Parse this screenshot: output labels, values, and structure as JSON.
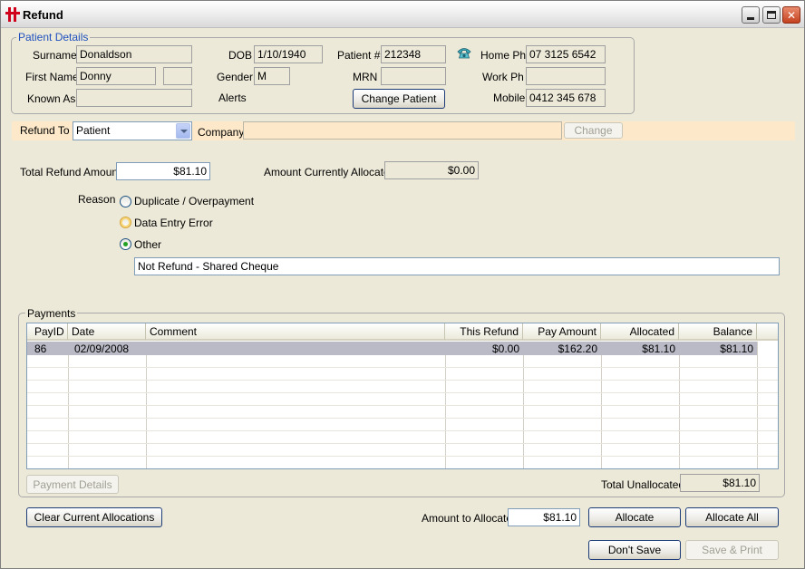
{
  "window": {
    "title": "Refund"
  },
  "patient_details": {
    "legend": "Patient Details",
    "surname_label": "Surname",
    "surname": "Donaldson",
    "firstname_label": "First Name",
    "firstname": "Donny",
    "initial": "",
    "knownas_label": "Known As",
    "knownas": "",
    "dob_label": "DOB",
    "dob": "1/10/1940",
    "gender_label": "Gender",
    "gender": "M",
    "alerts_label": "Alerts",
    "patientno_label": "Patient #",
    "patientno": "212348",
    "mrn_label": "MRN",
    "mrn": "",
    "change_patient": "Change Patient",
    "homeph_label": "Home Ph",
    "homeph": "07 3125 6542",
    "workph_label": "Work Ph",
    "workph": "",
    "mobile_label": "Mobile",
    "mobile": "0412 345 678"
  },
  "refund_to": {
    "label": "Refund To",
    "value": "Patient",
    "company_label": "Company",
    "company": "",
    "change_button": "Change"
  },
  "amounts": {
    "total_refund_label": "Total Refund Amount",
    "total_refund": "$81.10",
    "allocated_label": "Amount Currently Allocated",
    "allocated": "$0.00"
  },
  "reason": {
    "label": "Reason",
    "options": [
      "Duplicate / Overpayment",
      "Data Entry Error",
      "Other"
    ],
    "selected": "Other",
    "other_text": "Not Refund - Shared Cheque"
  },
  "payments": {
    "legend": "Payments",
    "columns": [
      "PayID",
      "Date",
      "Comment",
      "This Refund",
      "Pay Amount",
      "Allocated",
      "Balance"
    ],
    "rows": [
      {
        "payid": "86",
        "date": "02/09/2008",
        "comment": "",
        "this_refund": "$0.00",
        "pay_amount": "$162.20",
        "allocated": "$81.10",
        "balance": "$81.10"
      }
    ],
    "payment_details_button": "Payment Details",
    "total_unallocated_label": "Total Unallocated",
    "total_unallocated": "$81.10"
  },
  "actions": {
    "clear_allocations": "Clear Current Allocations",
    "amount_to_allocate_label": "Amount to Allocate",
    "amount_to_allocate": "$81.10",
    "allocate": "Allocate",
    "allocate_all": "Allocate All",
    "dont_save": "Don't Save",
    "save_print": "Save & Print"
  },
  "colors": {
    "refund_bar": "#fde9c9",
    "window_bg": "#ECE9D8",
    "selected_row": "#b9bac6"
  }
}
